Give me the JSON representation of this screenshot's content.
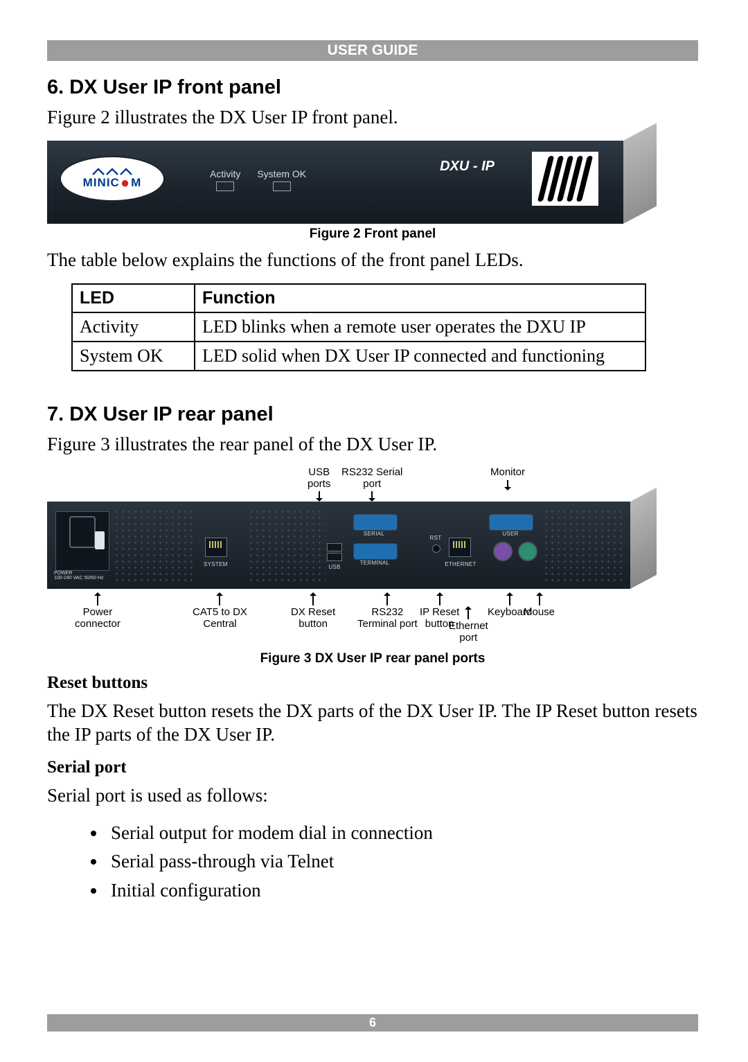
{
  "header": "USER GUIDE",
  "page_number": "6",
  "section6": {
    "heading": "6. DX User IP front panel",
    "intro": "Figure 2 illustrates the DX User IP front panel.",
    "caption": "Figure 2 Front panel",
    "after_figure": "The table below explains the functions of the front panel LEDs."
  },
  "front_panel": {
    "logo": "MINICOM",
    "model": "DXU - IP",
    "leds": [
      "Activity",
      "System OK"
    ]
  },
  "led_table": {
    "headers": [
      "LED",
      "Function"
    ],
    "rows": [
      [
        "Activity",
        "LED blinks when a remote user operates the DXU IP"
      ],
      [
        "System OK",
        "LED solid when DX User IP connected and functioning"
      ]
    ]
  },
  "section7": {
    "heading": "7. DX User IP rear panel",
    "intro": "Figure 3 illustrates the rear panel of the DX User IP.",
    "caption": "Figure 3 DX User IP rear panel ports"
  },
  "rear_labels_top": {
    "usb": "USB\nports",
    "serial": "RS232 Serial\nport",
    "monitor": "Monitor"
  },
  "rear_device": {
    "power_lbl": "POWER\n100-240 VAC 50/60 Hz",
    "system_lbl": "SYSTEM",
    "usb_lbl": "USB",
    "serial_lbl": "SERIAL",
    "terminal_lbl": "TERMINAL",
    "rst_lbl": "RST",
    "ethernet_lbl": "ETHERNET",
    "user_lbl": "USER",
    "kb_icon_lbl": "⌨",
    "ms_icon_lbl": "🖱"
  },
  "rear_labels_bottom": {
    "power": "Power\nconnector",
    "cat5": "CAT5 to DX\nCentral",
    "dxreset": "DX Reset\nbutton",
    "rs232t": "RS232\nTerminal port",
    "ipreset": "IP Reset\nbutton",
    "eth": "Ethernet\nport",
    "kb": "Keyboard",
    "mouse": "Mouse"
  },
  "reset_section": {
    "heading": "Reset buttons",
    "body": "The DX Reset button resets the DX parts of the DX User IP. The IP Reset button resets the IP parts of the DX User IP."
  },
  "serial_section": {
    "heading": "Serial port",
    "intro": "Serial port is used as follows:",
    "bullets": [
      "Serial output for modem dial in connection",
      "Serial pass-through via Telnet",
      "Initial configuration"
    ]
  }
}
